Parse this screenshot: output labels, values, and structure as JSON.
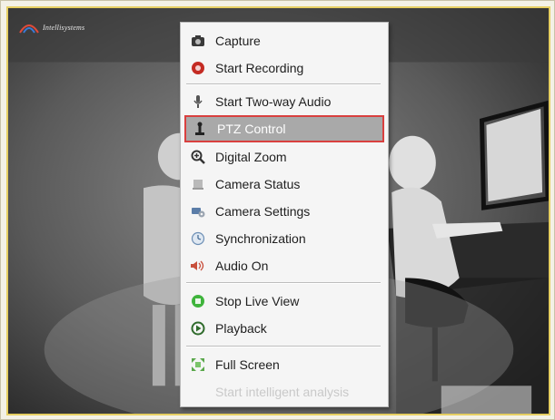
{
  "brand": {
    "logo_text": "Intellisystems"
  },
  "context_menu": {
    "items": [
      {
        "label": "Capture",
        "icon": "camera-icon",
        "enabled": true
      },
      {
        "label": "Start Recording",
        "icon": "record-icon",
        "enabled": true
      },
      {
        "label": "Start Two-way Audio",
        "icon": "microphone-icon",
        "enabled": true
      },
      {
        "label": "PTZ Control",
        "icon": "joystick-icon",
        "enabled": true,
        "highlighted": true
      },
      {
        "label": "Digital Zoom",
        "icon": "zoom-icon",
        "enabled": true
      },
      {
        "label": "Camera Status",
        "icon": "camera-status-icon",
        "enabled": true
      },
      {
        "label": "Camera Settings",
        "icon": "camera-settings-icon",
        "enabled": true
      },
      {
        "label": "Synchronization",
        "icon": "sync-icon",
        "enabled": true
      },
      {
        "label": "Audio On",
        "icon": "speaker-icon",
        "enabled": true
      },
      {
        "label": "Stop Live View",
        "icon": "stop-live-icon",
        "enabled": true
      },
      {
        "label": "Playback",
        "icon": "playback-icon",
        "enabled": true
      },
      {
        "label": "Full Screen",
        "icon": "fullscreen-icon",
        "enabled": true
      },
      {
        "label": "Start intelligent analysis",
        "icon": "",
        "enabled": false
      }
    ]
  },
  "colors": {
    "highlight_bg": "#a9a9a9",
    "highlight_border": "#d9403f",
    "video_border": "#e6cf62"
  }
}
